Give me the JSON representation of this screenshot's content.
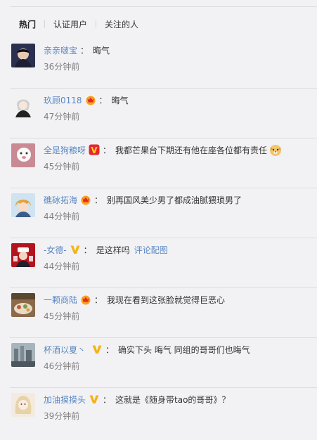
{
  "tabs": [
    {
      "label": "热门",
      "active": true
    },
    {
      "label": "认证用户",
      "active": false
    },
    {
      "label": "关注的人",
      "active": false
    }
  ],
  "colon": "：",
  "comments": [
    {
      "username": "亲亲啵宝",
      "badge": "",
      "text": "晦气",
      "link": "",
      "emoji": "",
      "time": "36分钟前",
      "avatar_color": "#2a3150"
    },
    {
      "username": "玖顾0118",
      "badge": "crown-icon",
      "text": "晦气",
      "link": "",
      "emoji": "",
      "time": "47分钟前",
      "avatar_color": "#f2f2f2"
    },
    {
      "username": "全是狗粮呀",
      "badge": "v-red-icon",
      "text": "我都芒果台下期还有他在座各位都有责任",
      "link": "",
      "emoji": "dog-face-icon",
      "time": "45分钟前",
      "avatar_color": "#c98a94"
    },
    {
      "username": "礁砅拓海",
      "badge": "crown-icon",
      "text": "别再国风美少男了都成油腻猥琐男了",
      "link": "",
      "emoji": "",
      "time": "44分钟前",
      "avatar_color": "#d9a24a"
    },
    {
      "username": "-女德-",
      "badge": "v-gold-icon",
      "text": "是这样吗",
      "link": "评论配图",
      "emoji": "",
      "time": "44分钟前",
      "avatar_color": "#b4141e"
    },
    {
      "username": "一颗商陆",
      "badge": "crown-icon",
      "text": "我现在看到这张脸就觉得巨恶心",
      "link": "",
      "emoji": "",
      "time": "45分钟前",
      "avatar_color": "#8a6a4a"
    },
    {
      "username": "杯酒以夏丶",
      "badge": "v-gold-icon",
      "text": "确实下头 晦气 同组的哥哥们也晦气",
      "link": "",
      "emoji": "",
      "time": "46分钟前",
      "avatar_color": "#8d98a0"
    },
    {
      "username": "加油摸摸头",
      "badge": "v-gold-icon",
      "text": "这就是《随身带tao的哥哥》？",
      "link": "",
      "emoji": "",
      "time": "39分钟前",
      "avatar_color": "#ead8c0"
    }
  ]
}
